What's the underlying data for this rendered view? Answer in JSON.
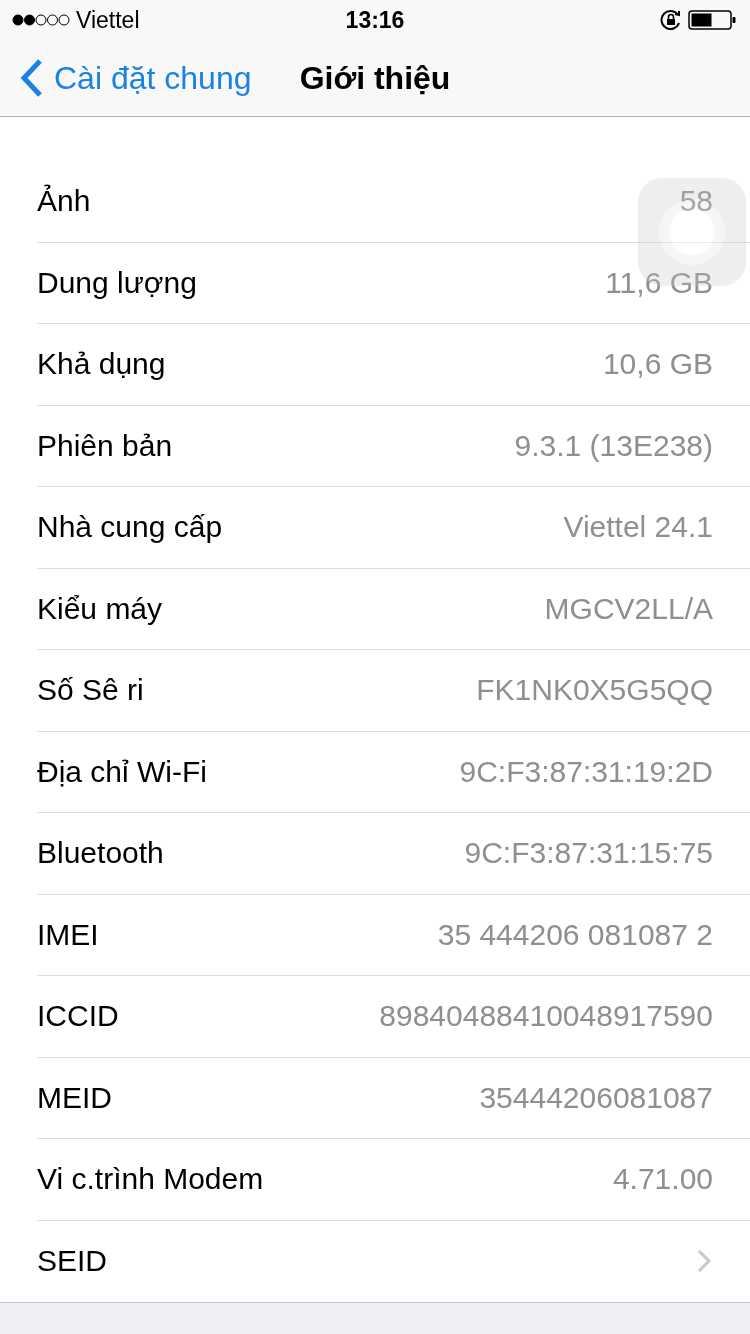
{
  "status_bar": {
    "carrier": "Viettel",
    "time": "13:16"
  },
  "nav_bar": {
    "back": "Cài đặt chung",
    "title": "Giới thiệu"
  },
  "rows": [
    {
      "kind": "value",
      "label": "Ảnh",
      "value": "58"
    },
    {
      "kind": "value",
      "label": "Dung lượng",
      "value": "11,6 GB"
    },
    {
      "kind": "value",
      "label": "Khả dụng",
      "value": "10,6 GB"
    },
    {
      "kind": "value",
      "label": "Phiên bản",
      "value": "9.3.1 (13E238)"
    },
    {
      "kind": "value",
      "label": "Nhà cung cấp",
      "value": "Viettel 24.1"
    },
    {
      "kind": "value",
      "label": "Kiểu máy",
      "value": "MGCV2LL/A"
    },
    {
      "kind": "value",
      "label": "Số Sê ri",
      "value": "FK1NK0X5G5QQ"
    },
    {
      "kind": "value",
      "label": "Địa chỉ Wi-Fi",
      "value": "9C:F3:87:31:19:2D"
    },
    {
      "kind": "value",
      "label": "Bluetooth",
      "value": "9C:F3:87:31:15:75"
    },
    {
      "kind": "value",
      "label": "IMEI",
      "value": "35 444206 081087 2"
    },
    {
      "kind": "value",
      "label": "ICCID",
      "value": "89840488410048917590"
    },
    {
      "kind": "value",
      "label": "MEID",
      "value": "35444206081087"
    },
    {
      "kind": "value",
      "label": "Vi c.trình Modem",
      "value": "4.71.00"
    },
    {
      "kind": "link",
      "label": "SEID"
    }
  ]
}
